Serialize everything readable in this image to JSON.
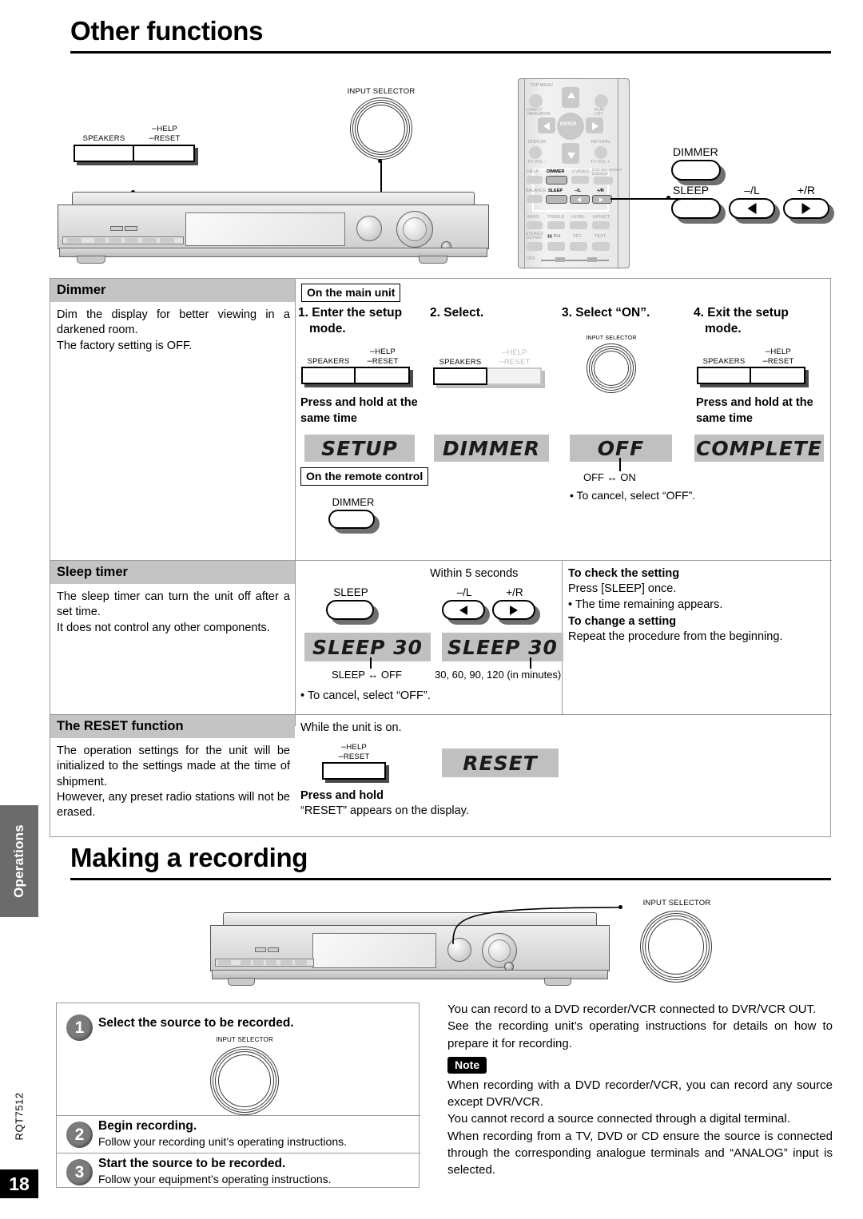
{
  "page": {
    "number": "18",
    "doc_code": "RQT7512",
    "side_tab": "Operations"
  },
  "headings": {
    "other_functions": "Other functions",
    "making_a_recording": "Making a recording"
  },
  "top_diagram": {
    "speakers_label": "SPEAKERS",
    "help_label": "HELP",
    "reset_label": "RESET",
    "input_selector_label": "INPUT SELECTOR",
    "remote_keys": {
      "dimmer": "DIMMER",
      "sleep": "SLEEP",
      "minus_l": "–/L",
      "plus_r": "+/R"
    },
    "remote_face_labels": [
      "TOP MENU",
      "DIRECT NAVIGATOR",
      "PLAY LIST",
      "ENTER",
      "DISPLAY",
      "RETURN",
      "TV VOL –",
      "TV VOL +",
      "HELP",
      "DIMMER",
      "V.VIDEO",
      "DVD RECORDER DVD/VCR",
      "BALANCE",
      "SLEEP",
      "–/L",
      "+/R",
      "BASS",
      "TREBLE",
      "LEVEL",
      "EFFECT",
      "STEREO/ 2CH MIX",
      "PLⅡ",
      "SFC",
      "TEST",
      "OFF"
    ]
  },
  "dimmer": {
    "title": "Dimmer",
    "description_line1": "Dim the display for better viewing in a darkened room.",
    "description_line2": "The factory setting is OFF.",
    "on_main_unit": "On the main unit",
    "on_remote_control": "On the remote control",
    "steps": [
      {
        "num": "1.",
        "title_line1": "Enter the setup",
        "title_line2": "mode."
      },
      {
        "num": "2.",
        "title_line1": "Select.",
        "title_line2": ""
      },
      {
        "num": "3.",
        "title_line1": "Select “ON”.",
        "title_line2": ""
      },
      {
        "num": "4.",
        "title_line1": "Exit the setup",
        "title_line2": "mode."
      }
    ],
    "press_hold_1": "Press and hold at the same time",
    "press_hold_4": "Press and hold at the same time",
    "displays": [
      "SETUP",
      "DIMMER",
      "OFF",
      "COMPLETE"
    ],
    "toggle_caption": "OFF ↔ ON",
    "cancel_note": "• To cancel, select “OFF”.",
    "remote_button": "DIMMER",
    "speakers_label": "SPEAKERS",
    "help_label": "HELP",
    "reset_label": "RESET",
    "input_selector_label": "INPUT SELECTOR"
  },
  "sleep_timer": {
    "title": "Sleep timer",
    "description_line1": "The sleep timer can turn the unit off after a set time.",
    "description_line2": "It does not control any other components.",
    "within_5_seconds": "Within 5 seconds",
    "sleep_key": "SLEEP",
    "minus_l": "–/L",
    "plus_r": "+/R",
    "display_1": "SLEEP 30",
    "display_2": "SLEEP 30",
    "caption_1": "SLEEP ↔ OFF",
    "caption_2": "30, 60, 90, 120 (in minutes)",
    "cancel_note": "• To cancel, select “OFF”.",
    "check_title": "To check the setting",
    "check_line1": "Press [SLEEP] once.",
    "check_line2": "• The time remaining appears.",
    "change_title": "To change a setting",
    "change_line1": "Repeat the procedure from the beginning."
  },
  "reset_function": {
    "title": "The RESET function",
    "description_line1": "The operation settings for the unit will be initialized to the settings made at the time of shipment.",
    "description_line2": "However, any preset radio stations will not be erased.",
    "while_on": "While the unit is on.",
    "help_label": "HELP",
    "reset_label": "RESET",
    "display": "RESET",
    "press_hold": "Press and hold",
    "appears": "“RESET” appears on the display."
  },
  "recording": {
    "input_selector_label": "INPUT SELECTOR",
    "steps": [
      {
        "num": "1",
        "title": "Select the source to be recorded.",
        "sub": ""
      },
      {
        "num": "2",
        "title": "Begin recording.",
        "sub": "Follow your recording unit’s operating instructions."
      },
      {
        "num": "3",
        "title": "Start the source to be recorded.",
        "sub": "Follow your equipment’s operating instructions."
      }
    ],
    "intro_line1": "You can record to a DVD recorder/VCR connected to DVR/VCR OUT.",
    "intro_line2": "See the recording unit’s operating instructions for details on how to prepare it for recording.",
    "note_label": "Note",
    "note_line1": "When recording with a DVD recorder/VCR, you can record any source except DVR/VCR.",
    "note_line2": "You cannot record a source connected through a digital terminal.",
    "note_line3": "When recording from a TV, DVD or CD ensure the source is connected through the corresponding analogue terminals and “ANALOG” input is selected."
  },
  "colors": {
    "lcd_background": "#c0c0c0",
    "section_header": "#c4c4c4",
    "side_tab": "#6b6b6b",
    "step_circle": "#7b7b7b",
    "rule": "#000000"
  }
}
